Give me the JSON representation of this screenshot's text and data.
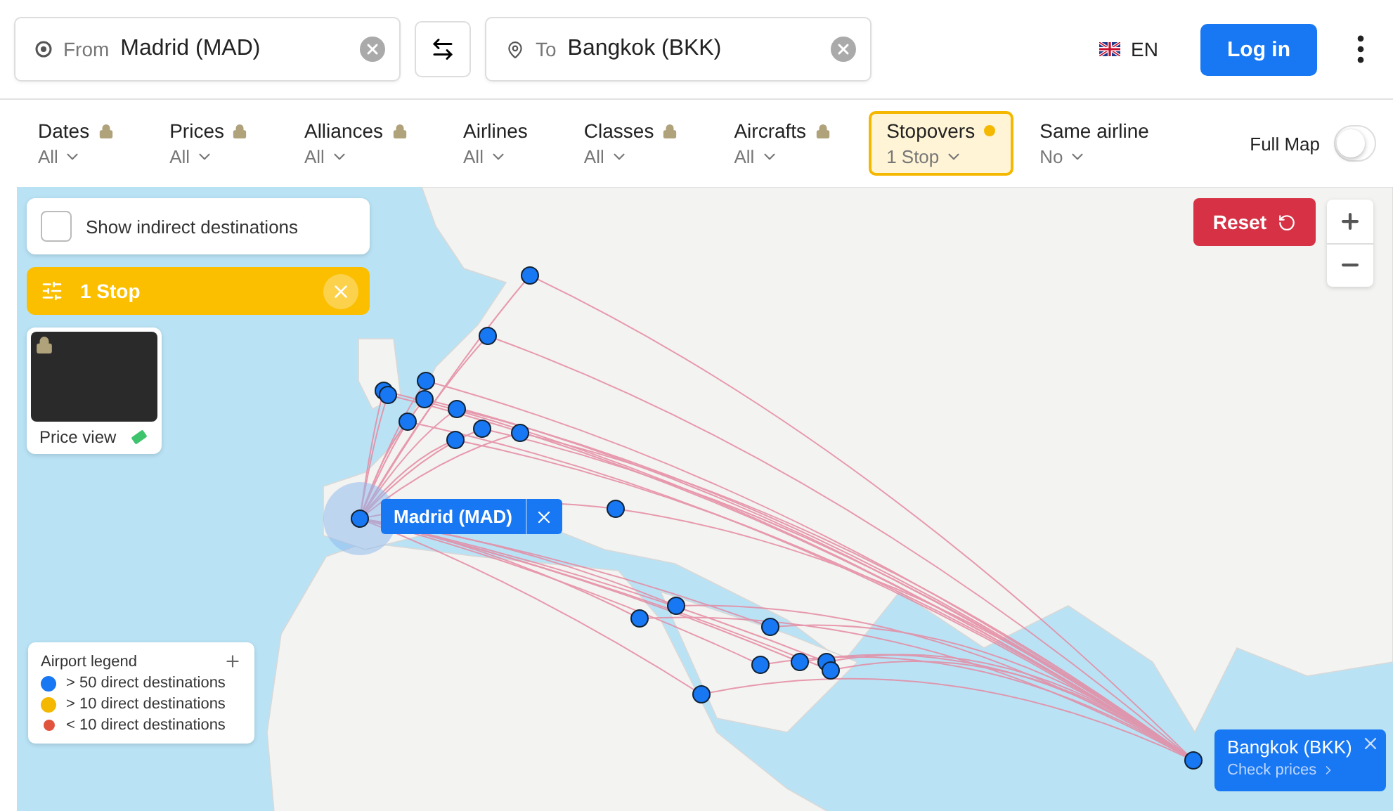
{
  "search": {
    "from": {
      "label": "From",
      "value": "Madrid (MAD)"
    },
    "to": {
      "label": "To",
      "value": "Bangkok (BKK)"
    }
  },
  "language": "EN",
  "login": "Log in",
  "filters": [
    {
      "label": "Dates",
      "value": "All",
      "locked": true,
      "selected": false
    },
    {
      "label": "Prices",
      "value": "All",
      "locked": true,
      "selected": false
    },
    {
      "label": "Alliances",
      "value": "All",
      "locked": true,
      "selected": false
    },
    {
      "label": "Airlines",
      "value": "All",
      "locked": false,
      "selected": false
    },
    {
      "label": "Classes",
      "value": "All",
      "locked": true,
      "selected": false
    },
    {
      "label": "Aircrafts",
      "value": "All",
      "locked": true,
      "selected": false
    },
    {
      "label": "Stopovers",
      "value": "1 Stop",
      "locked": false,
      "selected": true
    },
    {
      "label": "Same airline",
      "value": "No",
      "locked": false,
      "selected": false
    }
  ],
  "full_map": {
    "label": "Full Map",
    "on": false
  },
  "map": {
    "indirect": {
      "label": "Show indirect destinations",
      "checked": false
    },
    "stop_chip": "1 Stop",
    "price_view": {
      "label": "Price view",
      "locked": true
    },
    "reset": "Reset",
    "legend": {
      "title": "Airport legend",
      "items": [
        {
          "label": "> 50 direct destinations",
          "color": "#1877f2"
        },
        {
          "label": "> 10 direct destinations",
          "color": "#f5b800"
        },
        {
          "label": "< 10 direct destinations",
          "color": "#e0533d"
        }
      ]
    },
    "origin_popup": "Madrid (MAD)",
    "destination_popup": {
      "title": "Bangkok (BKK)",
      "link": "Check prices"
    }
  }
}
